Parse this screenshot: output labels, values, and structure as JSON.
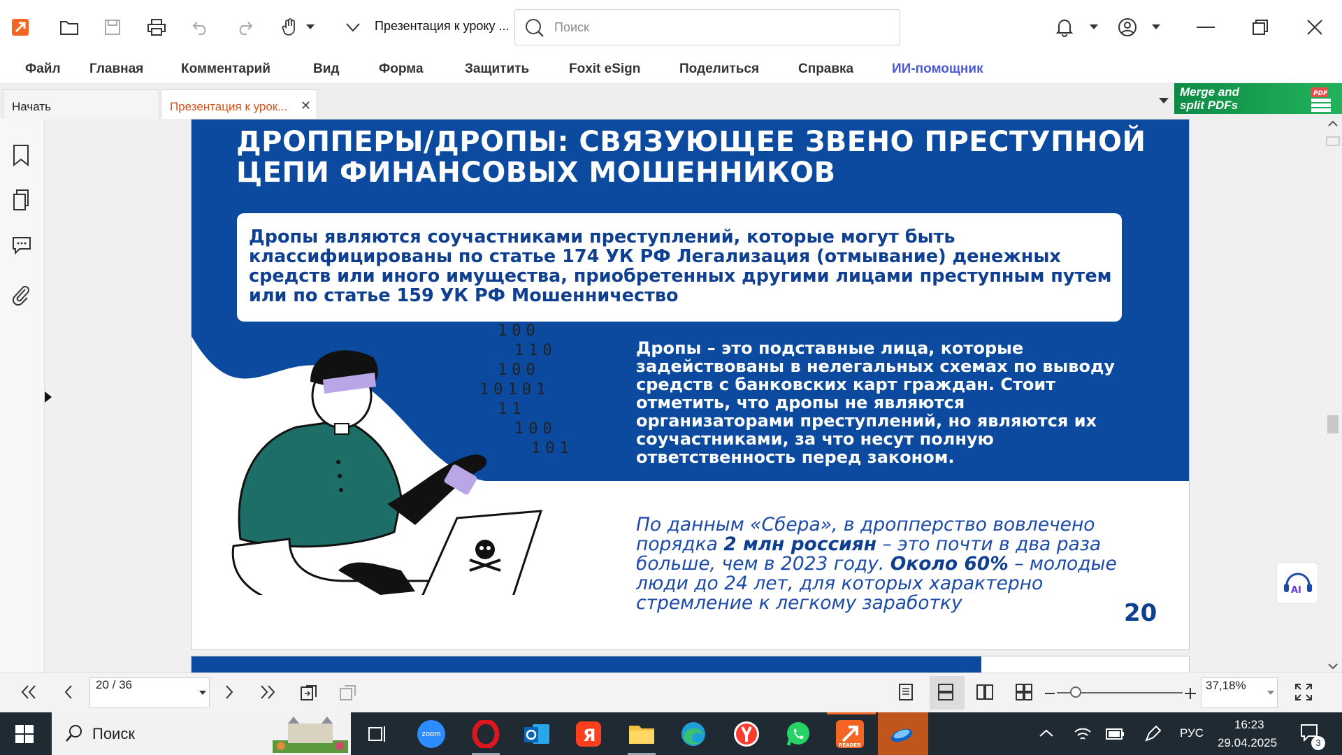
{
  "app": {
    "document_title": "Презентация к уроку ...",
    "search_placeholder": "Поиск"
  },
  "menu": {
    "items": [
      "Файл",
      "Главная",
      "Комментарий",
      "Вид",
      "Форма",
      "Защитить",
      "Foxit eSign",
      "Поделиться",
      "Справка",
      "ИИ-помощник"
    ]
  },
  "tabs": [
    {
      "label": "Начать"
    },
    {
      "label": "Презентация к урок...",
      "close": "✕"
    }
  ],
  "promo": {
    "line1": "Merge and",
    "line2": "split PDFs",
    "icon_label": "PDF"
  },
  "slide": {
    "title": "ДРОППЕРЫ/ДРОПЫ: СВЯЗУЮЩЕЕ ЗВЕНО ПРЕСТУПНОЙ ЦЕПИ ФИНАНСОВЫХ МОШЕННИКОВ",
    "box_text": "Дропы являются соучастниками преступлений, которые могут быть классифицированы по статье 174 УК РФ Легализация (отмывание) денежных средств или иного имущества, приобретенных другими лицами преступным путем или по статье 159 УК РФ Мошенничество",
    "right_text": "Дропы – это подставные лица, которые задействованы в нелегальных схемах по выводу средств с банковских карт граждан. Стоит отметить, что дропы не являются организаторами преступлений, но являются их соучастниками, за что несут полную ответственность перед законом.",
    "stat_part1": "По данным «Сбера», в дропперство вовлечено порядка ",
    "stat_bold1": "2 млн россиян",
    "stat_part2": " – это почти в два раза больше, чем в 2023 году. ",
    "stat_bold2": "Около 60%",
    "stat_part3": " – молодые люди до 24 лет, для которых характерно стремление к легкому заработку",
    "page_number": "20",
    "binary_rows": [
      "100",
      "110",
      "100",
      "10101",
      "11",
      "100",
      "101"
    ]
  },
  "ai_badge": "AI",
  "navigation": {
    "page_value": "20 / 36",
    "zoom_value": "37,18%",
    "zoom_fraction": 0.15
  },
  "taskbar": {
    "search_label": "Поиск",
    "apps": [
      "zoom",
      "opera",
      "outlook",
      "yandex",
      "explorer",
      "edge",
      "yandex-browser",
      "whatsapp",
      "foxit-reader",
      "app"
    ],
    "zoom_label": "zoom",
    "reader_label": "READER",
    "language": "РУС",
    "time": "16:23",
    "date": "29.04.2025",
    "notifications": "3"
  },
  "colors": {
    "slide_blue": "#0b4a9e",
    "foxit_orange": "#f26522",
    "ai_purple": "#4a58d8",
    "shirt_green": "#1d6e66"
  }
}
